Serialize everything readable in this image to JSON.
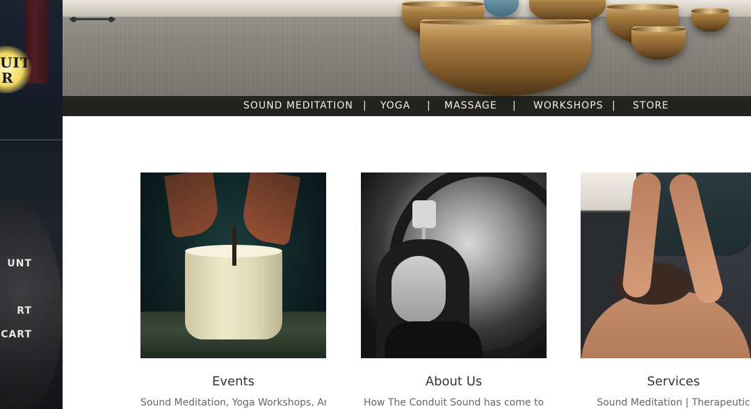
{
  "sidebar": {
    "logo_lines": [
      "UIT",
      "R"
    ],
    "links": [
      "UNT",
      "RT",
      "CART"
    ]
  },
  "hero": {
    "nav": [
      {
        "label": "SOUND MEDITATION"
      },
      {
        "label": "YOGA"
      },
      {
        "label": "MASSAGE"
      },
      {
        "label": "WORKSHOPS"
      },
      {
        "label": "STORE"
      }
    ],
    "separator": "|"
  },
  "cards": [
    {
      "title": "Events",
      "text": "Sound Meditation, Yoga Workshops, And"
    },
    {
      "title": "About Us",
      "text": "How The Conduit Sound has come to"
    },
    {
      "title": "Services",
      "text": "Sound Meditation | Therapeutic"
    }
  ],
  "colors": {
    "sidebar_bg": "#181d27",
    "nav_bg": "#161614",
    "nav_text": "#f4f1ea",
    "title_text": "#333333",
    "body_text": "#666666",
    "logo_glow": "#f2d860"
  }
}
